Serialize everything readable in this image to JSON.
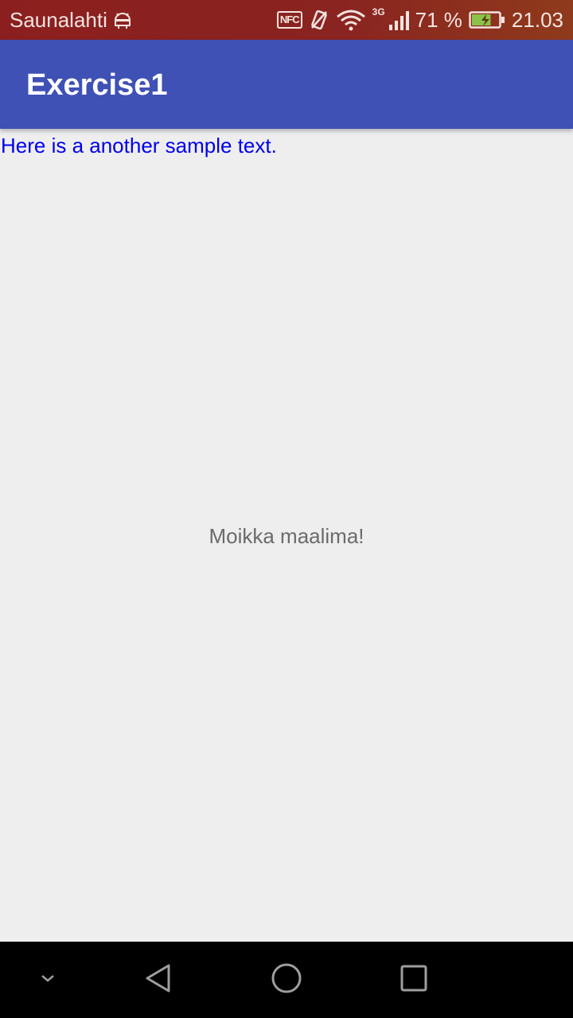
{
  "status_bar": {
    "carrier": "Saunalahti",
    "nfc_label": "NFC",
    "network_type": "3G",
    "battery_percent": "71 %",
    "battery_level": 0.71,
    "time": "21.03",
    "icons": [
      "android-debug-icon",
      "nfc-icon",
      "vibrate-icon",
      "wifi-icon",
      "signal-icon",
      "battery-charging-icon"
    ]
  },
  "app_bar": {
    "title": "Exercise1",
    "color": "#3f51b5"
  },
  "content": {
    "sample_text": "Here is a another sample text.",
    "sample_text_color": "#0000ee",
    "center_text": "Moikka maalima!"
  },
  "nav_bar": {
    "buttons": [
      "hide-keyboard-icon",
      "back-icon",
      "home-icon",
      "recents-icon"
    ]
  }
}
